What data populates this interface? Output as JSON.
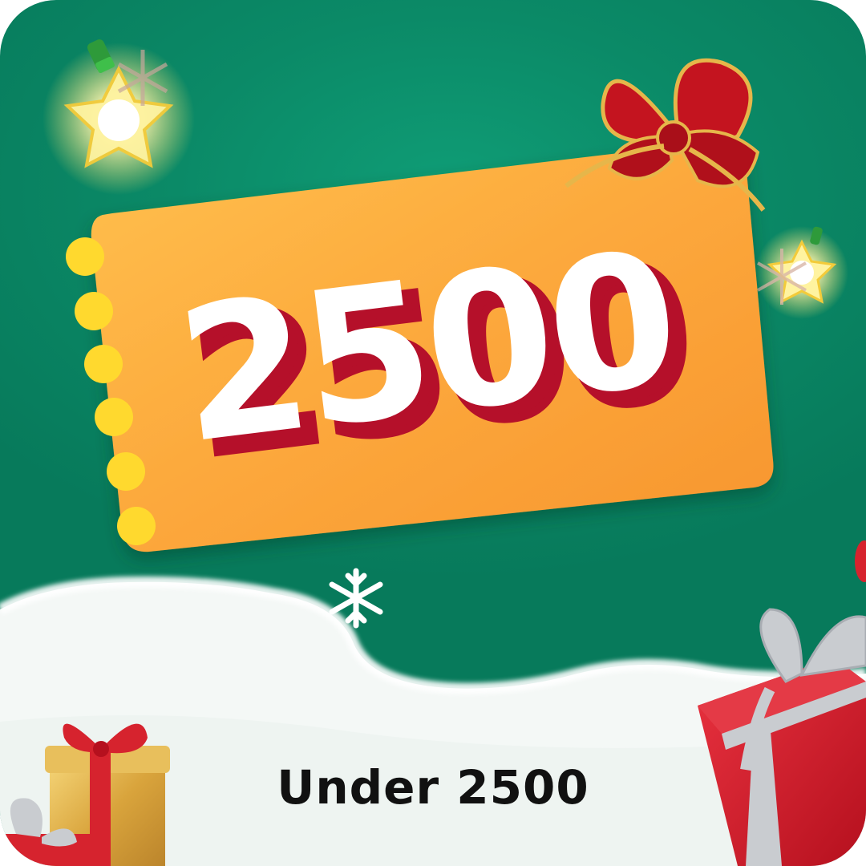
{
  "card": {
    "amount": "2500",
    "caption": "Under 2500"
  },
  "colors": {
    "background": "#0b8a67",
    "ticket": "#fba43a",
    "ticket_dots": "#ffd92e",
    "amount_fill": "#ffffff",
    "amount_shadow": "#b5102a",
    "snow": "#f4f8f6",
    "gift_red": "#d6232e",
    "ribbon_silver": "#c9ccd0",
    "bow_red": "#c4141f",
    "bow_gold": "#e6b64a"
  },
  "icons": [
    "star-light-icon",
    "snowflake-icon",
    "bow-icon",
    "gift-box-icon"
  ]
}
